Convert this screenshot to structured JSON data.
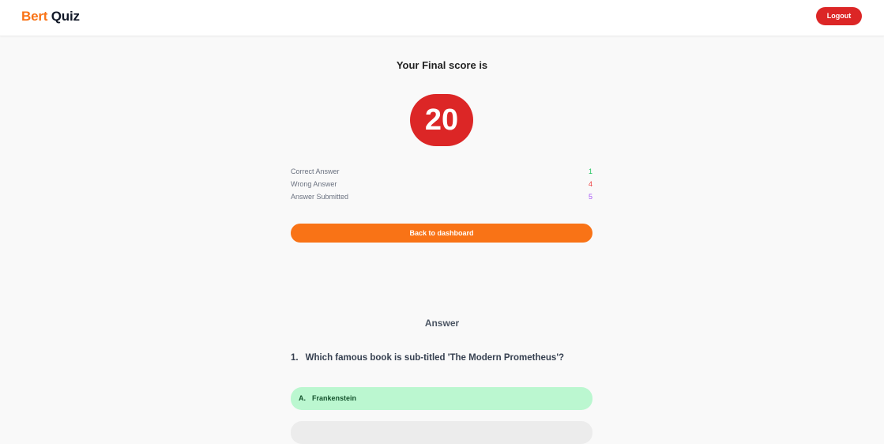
{
  "header": {
    "logo_part1": "Bert",
    "logo_part2": "Quiz",
    "logout_label": "Logout"
  },
  "result": {
    "title": "Your Final score is",
    "score": "20",
    "stats": [
      {
        "label": "Correct Answer",
        "value": "1",
        "color": "#22c55e"
      },
      {
        "label": "Wrong Answer",
        "value": "4",
        "color": "#ef4444"
      },
      {
        "label": "Answer Submitted",
        "value": "5",
        "color": "#a855f7"
      }
    ],
    "back_label": "Back to dashboard"
  },
  "answers": {
    "heading": "Answer",
    "question_number": "1.",
    "question_text": "Which famous book is sub-titled 'The Modern Prometheus'?",
    "options": [
      {
        "letter": "A.",
        "text": "Frankenstein",
        "state": "correct"
      }
    ]
  },
  "colors": {
    "brand_orange": "#f97316",
    "accent_red": "#dc2626",
    "correct_green_bg": "#bbf7d0"
  }
}
